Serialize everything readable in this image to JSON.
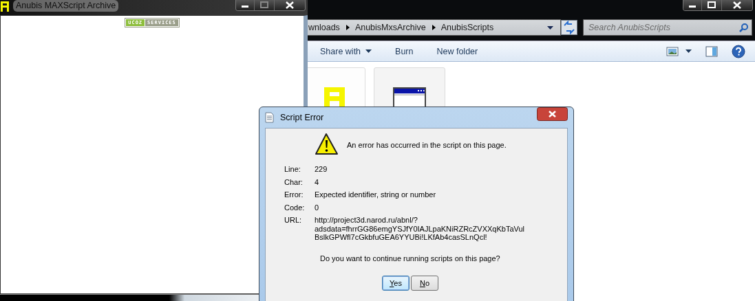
{
  "browser_window": {
    "title": "Anubis MAXScript Archive",
    "badge": [
      "UCOZ",
      "SERVICES"
    ]
  },
  "explorer": {
    "breadcrumbs": [
      "wnloads",
      "AnubisMxsArchive",
      "AnubisScripts"
    ],
    "search": {
      "placeholder": "Search AnubisScripts"
    },
    "toolbar": [
      {
        "label": "Share with",
        "dropdown": true
      },
      {
        "label": "Burn",
        "dropdown": false
      },
      {
        "label": "New folder",
        "dropdown": false
      }
    ],
    "files": [
      {
        "kind": "logo"
      },
      {
        "kind": "window"
      }
    ]
  },
  "dialog": {
    "title": "Script Error",
    "message": "An error has occurred in the script on this page.",
    "details": [
      {
        "label": "Line:",
        "value": "229"
      },
      {
        "label": "Char:",
        "value": "4"
      },
      {
        "label": "Error:",
        "value": "Expected identifier, string or number"
      },
      {
        "label": "Code:",
        "value": "0"
      },
      {
        "label": "URL:",
        "value": "http://project3d.narod.ru/abnl/?\nadsdata=fhrrGG86emgYSJfY0IAJLpaKNiRZRcZVXXqKbTaVul\nBslkGPWfl7cGkbfuGEA6YYUBi!LKfAb4casSLnQcl!"
      }
    ],
    "question": "Do you want to continue running scripts on this page?",
    "buttons": [
      {
        "label": "Yes",
        "selected": true
      },
      {
        "label": "No",
        "selected": false
      }
    ]
  }
}
